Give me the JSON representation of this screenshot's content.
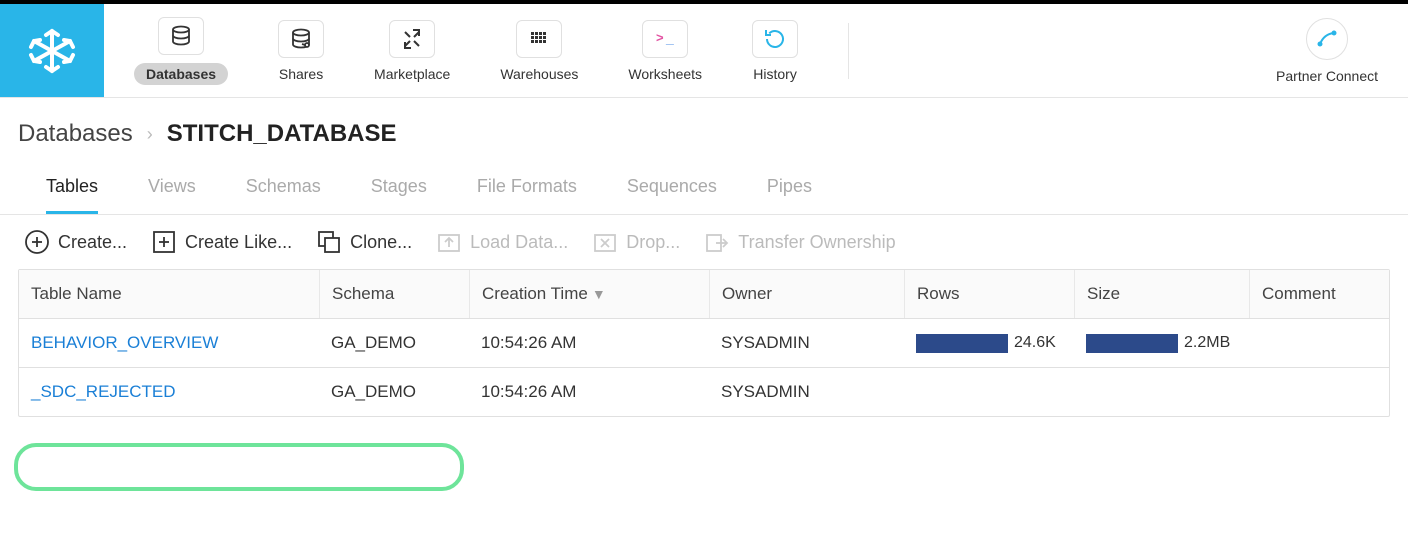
{
  "nav": {
    "items": [
      {
        "label": "Databases",
        "active": true
      },
      {
        "label": "Shares",
        "active": false
      },
      {
        "label": "Marketplace",
        "active": false
      },
      {
        "label": "Warehouses",
        "active": false
      },
      {
        "label": "Worksheets",
        "active": false
      },
      {
        "label": "History",
        "active": false
      }
    ],
    "partner_connect": "Partner Connect"
  },
  "breadcrumb": {
    "root": "Databases",
    "sep": "›",
    "current": "STITCH_DATABASE"
  },
  "section_tabs": [
    {
      "label": "Tables",
      "active": true
    },
    {
      "label": "Views"
    },
    {
      "label": "Schemas"
    },
    {
      "label": "Stages"
    },
    {
      "label": "File Formats"
    },
    {
      "label": "Sequences"
    },
    {
      "label": "Pipes"
    }
  ],
  "toolbar": {
    "create": "Create...",
    "create_like": "Create Like...",
    "clone": "Clone...",
    "load_data": "Load Data...",
    "drop": "Drop...",
    "transfer": "Transfer Ownership"
  },
  "table": {
    "headers": {
      "name": "Table Name",
      "schema": "Schema",
      "creation": "Creation Time",
      "owner": "Owner",
      "rows": "Rows",
      "size": "Size",
      "comment": "Comment"
    },
    "rows": [
      {
        "name": "BEHAVIOR_OVERVIEW",
        "schema": "GA_DEMO",
        "creation": "10:54:26 AM",
        "owner": "SYSADMIN",
        "rows_text": "24.6K",
        "size_text": "2.2MB",
        "has_bars": true
      },
      {
        "name": "_SDC_REJECTED",
        "schema": "GA_DEMO",
        "creation": "10:54:26 AM",
        "owner": "SYSADMIN",
        "rows_text": "",
        "size_text": "",
        "has_bars": false
      }
    ]
  }
}
